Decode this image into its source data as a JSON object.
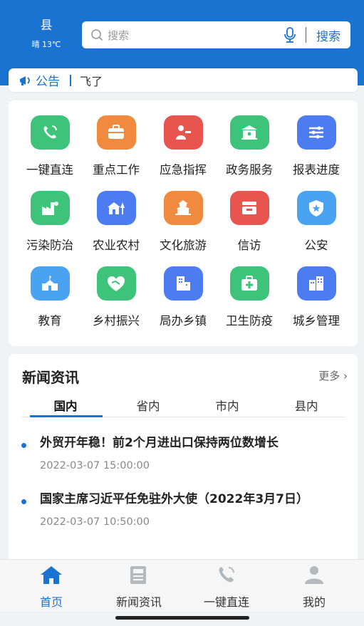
{
  "header": {
    "city": "县",
    "weather": "晴 13℃",
    "search_placeholder": "搜索",
    "search_button": "搜索"
  },
  "notice": {
    "label": "公告",
    "text": "飞了"
  },
  "grid": {
    "items": [
      {
        "label": "一键直连",
        "icon": "phone-call-icon",
        "color": "#3ec47a"
      },
      {
        "label": "重点工作",
        "icon": "briefcase-icon",
        "color": "#f08a3e"
      },
      {
        "label": "应急指挥",
        "icon": "commander-icon",
        "color": "#e8554e"
      },
      {
        "label": "政务服务",
        "icon": "government-building-icon",
        "color": "#3ec47a"
      },
      {
        "label": "报表进度",
        "icon": "progress-sliders-icon",
        "color": "#4c7cf0"
      },
      {
        "label": "污染防治",
        "icon": "factory-icon",
        "color": "#3ec47a"
      },
      {
        "label": "农业农村",
        "icon": "farmhouse-icon",
        "color": "#4c7cf0"
      },
      {
        "label": "文化旅游",
        "icon": "pagoda-icon",
        "color": "#f08a3e"
      },
      {
        "label": "信访",
        "icon": "inbox-icon",
        "color": "#e8554e"
      },
      {
        "label": "公安",
        "icon": "police-shield-icon",
        "color": "#4aa3f0"
      },
      {
        "label": "教育",
        "icon": "school-icon",
        "color": "#4aa3f0"
      },
      {
        "label": "乡村振兴",
        "icon": "handshake-heart-icon",
        "color": "#3ec47a"
      },
      {
        "label": "局办乡镇",
        "icon": "office-building-icon",
        "color": "#4c7cf0"
      },
      {
        "label": "卫生防疫",
        "icon": "medical-kit-icon",
        "color": "#3ec47a"
      },
      {
        "label": "城乡管理",
        "icon": "city-buildings-icon",
        "color": "#4c7cf0"
      }
    ]
  },
  "news": {
    "title": "新闻资讯",
    "more": "更多 ›",
    "tabs": [
      "国内",
      "省内",
      "市内",
      "县内"
    ],
    "active_tab": "国内",
    "items": [
      {
        "headline": "外贸开年稳！前2个月进出口保持两位数增长",
        "date": "2022-03-07 15:00:00"
      },
      {
        "headline": "国家主席习近平任免驻外大使（2022年3月7日）",
        "date": "2022-03-07 10:50:00"
      }
    ]
  },
  "bottom_nav": {
    "items": [
      {
        "label": "首页",
        "icon": "home-icon",
        "active": true
      },
      {
        "label": "新闻资讯",
        "icon": "newspaper-icon",
        "active": false
      },
      {
        "label": "一键直连",
        "icon": "phone-icon",
        "active": false
      },
      {
        "label": "我的",
        "icon": "user-icon",
        "active": false
      }
    ]
  },
  "colors": {
    "brand_blue": "#1a73d0",
    "page_background": "#f1f2f4"
  }
}
